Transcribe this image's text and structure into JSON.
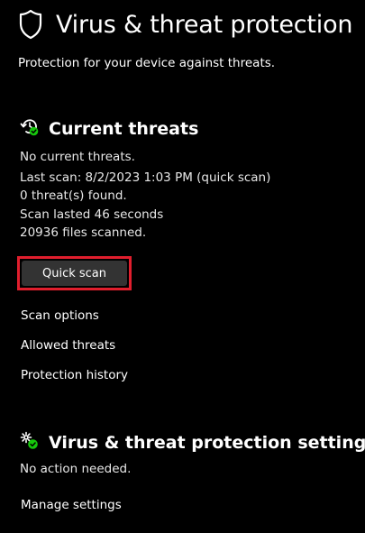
{
  "header": {
    "title": "Virus & threat protection",
    "subtitle": "Protection for your device against threats.",
    "icon": "shield-icon"
  },
  "current_threats": {
    "title": "Current threats",
    "icon": "history-check-icon",
    "status": "No current threats.",
    "last_scan": "Last scan: 8/2/2023 1:03 PM (quick scan)",
    "threats_found": "0 threat(s) found.",
    "scan_duration": "Scan lasted 46 seconds",
    "files_scanned": "20936 files scanned.",
    "quick_scan_label": "Quick scan",
    "links": {
      "scan_options": "Scan options",
      "allowed_threats": "Allowed threats",
      "protection_history": "Protection history"
    }
  },
  "settings": {
    "title": "Virus & threat protection settings",
    "icon": "settings-gear-check-icon",
    "status": "No action needed.",
    "manage_link": "Manage settings"
  },
  "colors": {
    "background": "#000000",
    "text": "#ffffff",
    "button_bg": "#333333",
    "highlight_border": "#e01e2d",
    "ok_green": "#16c60c"
  }
}
